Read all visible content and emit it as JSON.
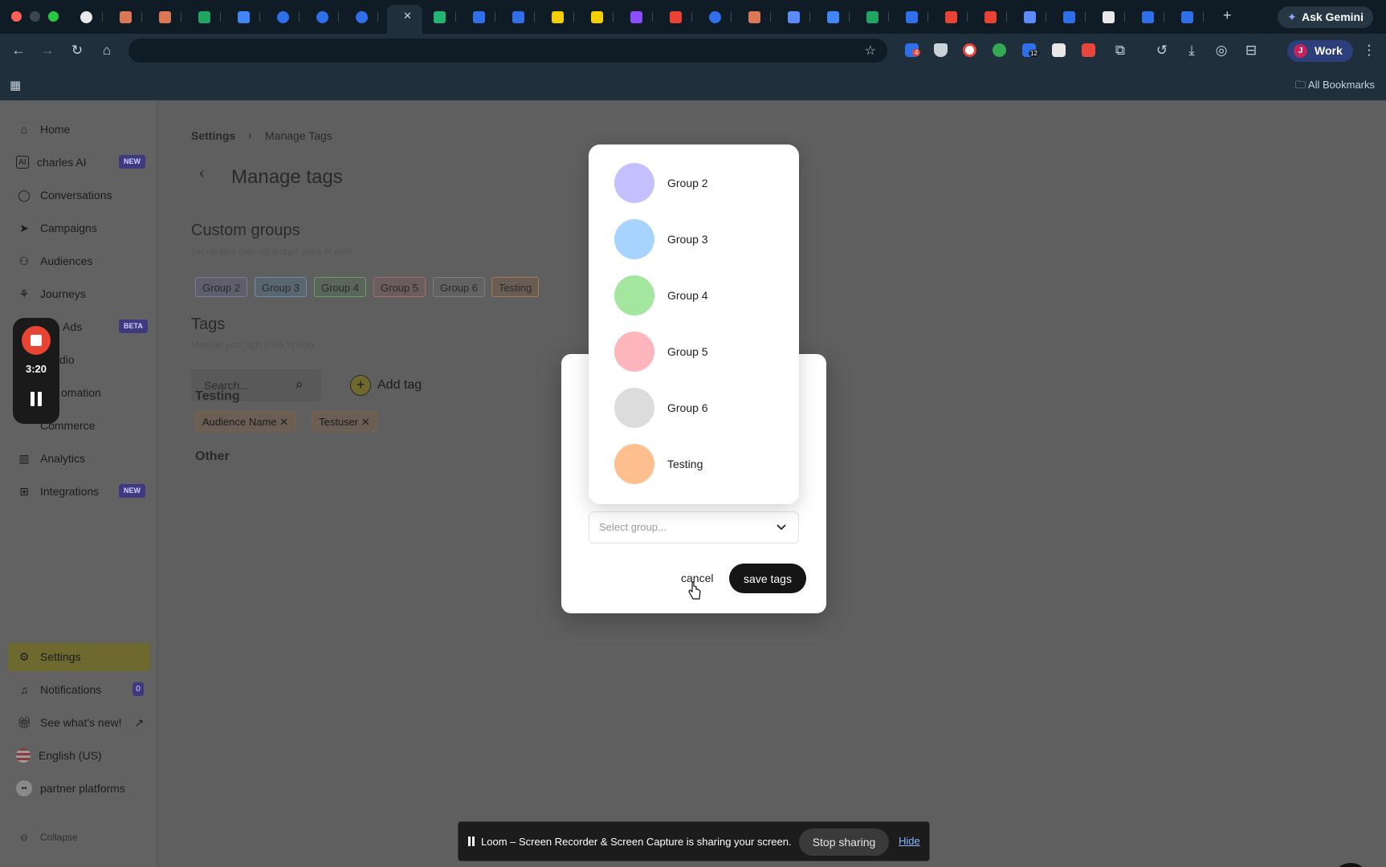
{
  "browser": {
    "ask_gemini": "Ask Gemini",
    "profile_label": "Work",
    "profile_initial": "J",
    "all_bookmarks": "All Bookmarks",
    "extension_badges": [
      "4",
      "12"
    ],
    "colors": {
      "tabbar": "#0f1c26",
      "toolbar": "#1f2f3b",
      "profile": "#2c3f7a"
    }
  },
  "sidebar": {
    "items": [
      {
        "label": "Home",
        "icon": "home-icon"
      },
      {
        "label": "charles AI",
        "icon": "ai-icon",
        "badge": "NEW"
      },
      {
        "label": "Conversations",
        "icon": "chat-icon"
      },
      {
        "label": "Campaigns",
        "icon": "send-icon"
      },
      {
        "label": "Audiences",
        "icon": "users-icon"
      },
      {
        "label": "Journeys",
        "icon": "journey-icon"
      },
      {
        "label": "Ads",
        "icon": "ads-icon",
        "badge": "BETA"
      },
      {
        "label": "dio",
        "icon": "studio-icon"
      },
      {
        "label": "omation",
        "icon": "automation-icon"
      },
      {
        "label": "Commerce",
        "icon": "cart-icon"
      },
      {
        "label": "Analytics",
        "icon": "analytics-icon"
      },
      {
        "label": "Integrations",
        "icon": "integrations-icon",
        "badge": "NEW"
      }
    ],
    "bottom": {
      "settings": "Settings",
      "notifications": "Notifications",
      "notifications_count": "0",
      "whats_new": "See what's new!",
      "language": "English (US)",
      "partner": "partner platforms",
      "collapse": "Collapse"
    }
  },
  "loom_widget": {
    "time": "3:20"
  },
  "page": {
    "breadcrumb_root": "Settings",
    "breadcrumb_current": "Manage Tags",
    "title": "Manage tags",
    "custom_groups_title": "Custom groups",
    "custom_groups_subtitle": "Set up your own tag groups (click to edit)",
    "groups": [
      "Group 2",
      "Group 3",
      "Group 4",
      "Group 5",
      "Group 6",
      "Testing"
    ],
    "tags_title": "Tags",
    "tags_subtitle": "Manage your tags (click to edit)",
    "search_placeholder": "Search...",
    "add_tag": "Add tag",
    "testing_section": "Testing",
    "testing_tags": [
      "Audience Name",
      "Testuser"
    ],
    "other_section": "Other"
  },
  "modal": {
    "select_placeholder": "Select group...",
    "cancel": "cancel",
    "save": "save tags",
    "options": [
      {
        "label": "Group 2",
        "color": "#c5c0ff"
      },
      {
        "label": "Group 3",
        "color": "#a6d4ff"
      },
      {
        "label": "Group 4",
        "color": "#a3e6a0"
      },
      {
        "label": "Group 5",
        "color": "#ffb5bc"
      },
      {
        "label": "Group 6",
        "color": "#dcdcdc"
      },
      {
        "label": "Testing",
        "color": "#ffbf8f"
      }
    ]
  },
  "loom_bar": {
    "message": "Loom – Screen Recorder & Screen Capture is sharing your screen.",
    "stop": "Stop sharing",
    "hide": "Hide"
  }
}
